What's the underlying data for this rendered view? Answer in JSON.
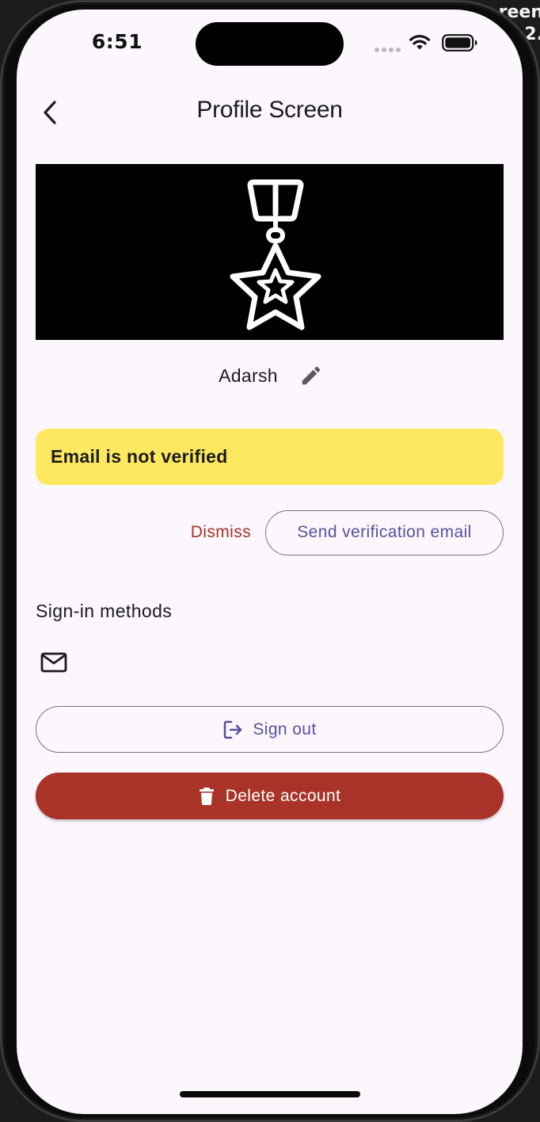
{
  "background": {
    "corner_text_lines": [
      "reen",
      "2."
    ]
  },
  "status_bar": {
    "time": "6:51"
  },
  "app_bar": {
    "title": "Profile Screen",
    "back_icon": "chevron-left-icon"
  },
  "profile": {
    "banner_icon": "medal-star-icon",
    "display_name": "Adarsh",
    "edit_icon": "pencil-icon"
  },
  "verification": {
    "warning_text": "Email is not verified",
    "dismiss_label": "Dismiss",
    "send_label": "Send verification email"
  },
  "sign_in_methods": {
    "title": "Sign-in methods",
    "methods": [
      {
        "icon": "mail-icon"
      }
    ]
  },
  "actions": {
    "sign_out_label": "Sign out",
    "sign_out_icon": "logout-icon",
    "delete_label": "Delete account",
    "delete_icon": "trash-icon"
  },
  "colors": {
    "background": "#fcf7fd",
    "primary": "#5b4f9e",
    "error": "#a93328",
    "warning": "#fde85f",
    "outline": "#75737b"
  }
}
